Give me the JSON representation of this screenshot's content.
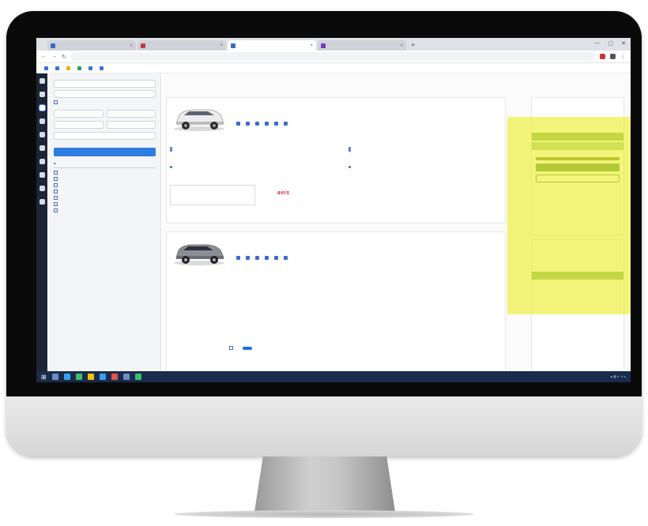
{
  "browser": {
    "tabs": [
      {
        "title": "",
        "active": false
      },
      {
        "title": "",
        "active": false
      },
      {
        "title": "",
        "active": true
      },
      {
        "title": "",
        "active": false
      }
    ],
    "new_tab": "+",
    "url": ""
  },
  "bookmarks": [
    {
      "label": "",
      "color": "#3b6fd6"
    },
    {
      "label": "",
      "color": "#3b6fd6"
    },
    {
      "label": "",
      "color": "#e6b400"
    },
    {
      "label": "",
      "color": "#2e9d57"
    },
    {
      "label": "",
      "color": "#3b6fd6"
    },
    {
      "label": "",
      "color": "#3b6fd6"
    }
  ],
  "sidebar": {
    "title": "",
    "tag": "",
    "items_note": ""
  },
  "main": {
    "results_header": "",
    "cards": [
      {
        "title": "",
        "subtitle": ""
      },
      {
        "title": "",
        "subtitle": ""
      }
    ],
    "brand_logo": "avis"
  },
  "compare": {
    "text": "",
    "button": "",
    "cancel": ""
  },
  "colors": {
    "highlight": "#eced28",
    "primary_blue": "#2f7de1",
    "green": "#7fb36f",
    "sidebar_rail": "#1c2536",
    "taskbar": "#1a2b4b"
  }
}
